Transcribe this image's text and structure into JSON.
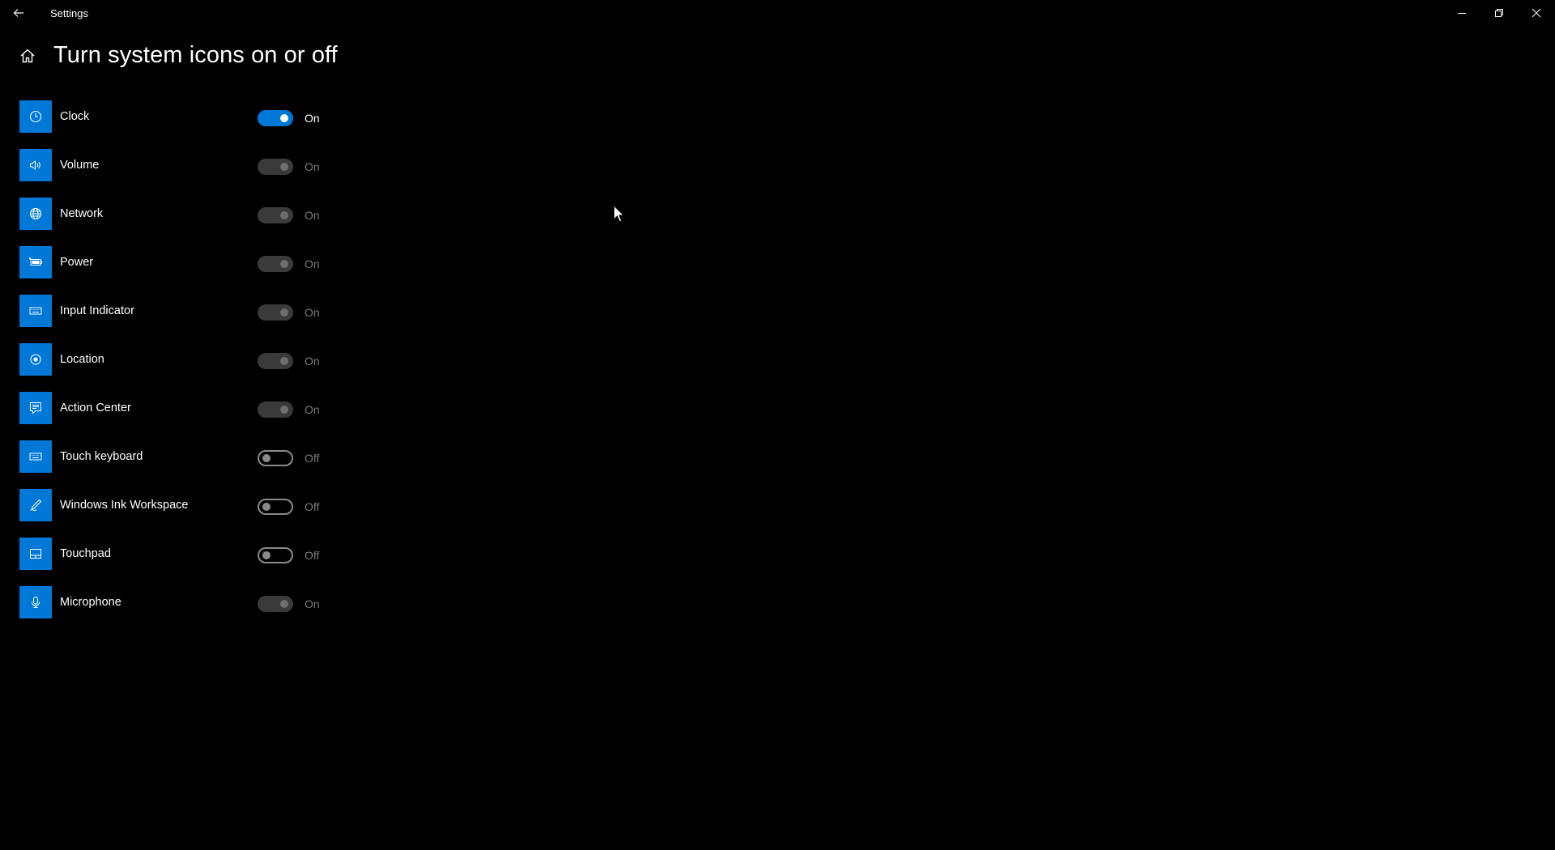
{
  "window": {
    "title": "Settings"
  },
  "page": {
    "title": "Turn system icons on or off"
  },
  "colors": {
    "accent": "#0078d7",
    "background": "#000000",
    "disabled_track": "#3a3a3a",
    "disabled_text": "#7a7a7a"
  },
  "items": [
    {
      "label": "Clock",
      "icon": "clock-icon",
      "state": "On",
      "mode": "on-active"
    },
    {
      "label": "Volume",
      "icon": "volume-icon",
      "state": "On",
      "mode": "on-disabled"
    },
    {
      "label": "Network",
      "icon": "globe-icon",
      "state": "On",
      "mode": "on-disabled"
    },
    {
      "label": "Power",
      "icon": "battery-icon",
      "state": "On",
      "mode": "on-disabled"
    },
    {
      "label": "Input Indicator",
      "icon": "keyboard-icon",
      "state": "On",
      "mode": "on-disabled"
    },
    {
      "label": "Location",
      "icon": "location-icon",
      "state": "On",
      "mode": "on-disabled"
    },
    {
      "label": "Action Center",
      "icon": "action-center-icon",
      "state": "On",
      "mode": "on-disabled"
    },
    {
      "label": "Touch keyboard",
      "icon": "touch-keyboard-icon",
      "state": "Off",
      "mode": "off"
    },
    {
      "label": "Windows Ink Workspace",
      "icon": "pen-icon",
      "state": "Off",
      "mode": "off"
    },
    {
      "label": "Touchpad",
      "icon": "touchpad-icon",
      "state": "Off",
      "mode": "off"
    },
    {
      "label": "Microphone",
      "icon": "microphone-icon",
      "state": "On",
      "mode": "on-disabled"
    }
  ]
}
